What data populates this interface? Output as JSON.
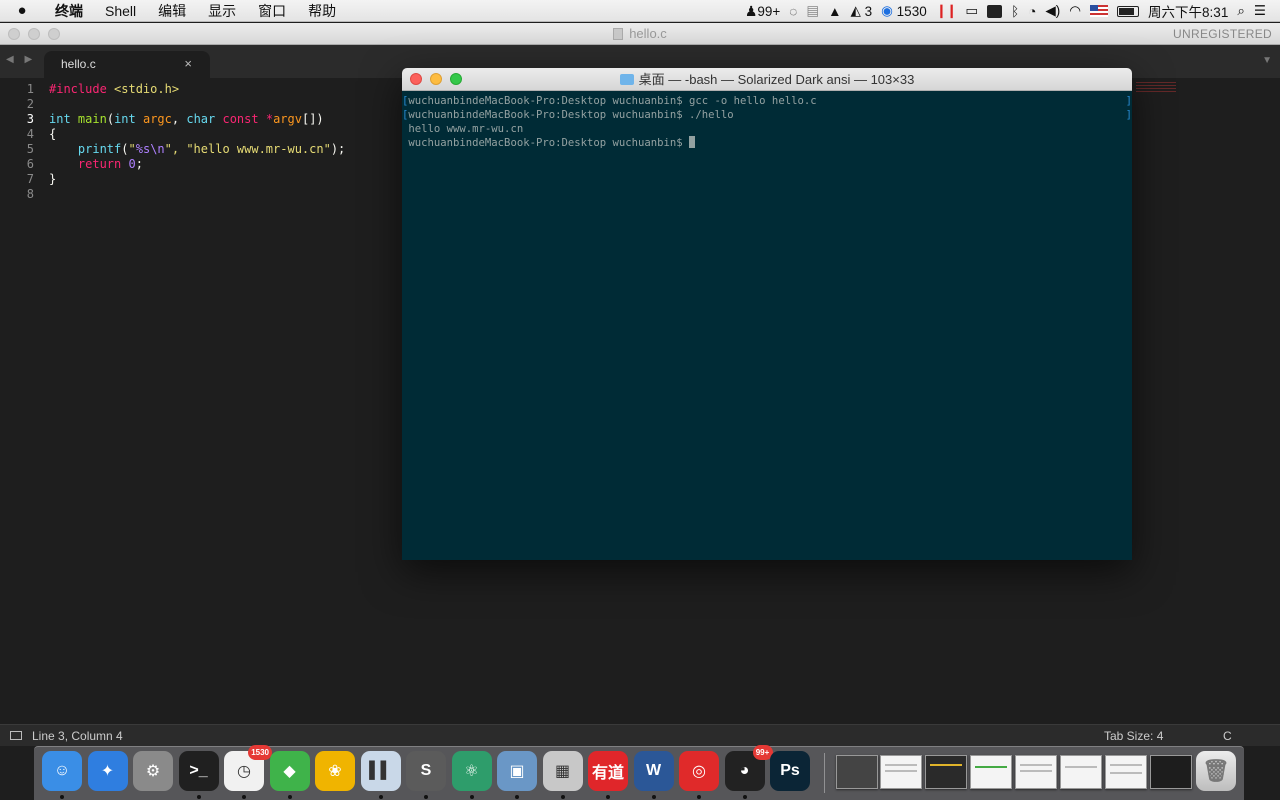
{
  "menubar": {
    "apple": "",
    "items": [
      "终端",
      "Shell",
      "编辑",
      "显示",
      "窗口",
      "帮助"
    ],
    "status": {
      "qq_badge": "99+",
      "adobe_count": "3",
      "timer_count": "1530",
      "clock": "周六下午8:31"
    }
  },
  "sublime": {
    "window_title": "hello.c",
    "unregistered": "UNREGISTERED",
    "tab_label": "hello.c",
    "tab_close": "×",
    "line_numbers": [
      "1",
      "2",
      "3",
      "4",
      "5",
      "6",
      "7",
      "8"
    ],
    "code": {
      "l1_directive": "#include",
      "l1_header": "<stdio.h>",
      "l3_type": "int",
      "l3_fn": "main",
      "l3_open": "(",
      "l3_type2": "int",
      "l3_param1": "argc",
      "l3_comma": ", ",
      "l3_type3": "char",
      "l3_const": "const",
      "l3_star": "*",
      "l3_param2": "argv",
      "l3_close": "[])",
      "l4": "{",
      "l5_fn": "printf",
      "l5_open": "(",
      "l5_q1": "\"",
      "l5_fmt": "%s",
      "l5_esc": "\\n",
      "l5_str1_end": "\", ",
      "l5_str2": "\"hello www.mr-wu.cn\"",
      "l5_end": ");",
      "l6_kw": "return",
      "l6_num": "0",
      "l6_end": ";",
      "l7": "}"
    },
    "status": {
      "position": "Line 3, Column 4",
      "tab_size": "Tab Size: 4",
      "syntax": "C"
    }
  },
  "terminal": {
    "title": "桌面 — -bash — Solarized Dark ansi — 103×33",
    "lines": [
      "wuchuanbindeMacBook-Pro:Desktop wuchuanbin$ gcc -o hello hello.c",
      "wuchuanbindeMacBook-Pro:Desktop wuchuanbin$ ./hello",
      "hello www.mr-wu.cn",
      "wuchuanbindeMacBook-Pro:Desktop wuchuanbin$ "
    ]
  },
  "dock": {
    "apps": [
      {
        "name": "finder-icon",
        "glyph": "☺",
        "color": "#3a8ee6"
      },
      {
        "name": "safari-icon",
        "glyph": "✦",
        "color": "#2f7ee0"
      },
      {
        "name": "system-preferences-icon",
        "glyph": "⚙",
        "color": "#8a8a8a"
      },
      {
        "name": "terminal-icon",
        "glyph": ">_",
        "color": "#202020"
      },
      {
        "name": "time-tracker-icon",
        "glyph": "◷",
        "color": "#f1f1f1",
        "badge": "1530"
      },
      {
        "name": "evernote-icon",
        "glyph": "◆",
        "color": "#3fb34a"
      },
      {
        "name": "tes-icon",
        "glyph": "❀",
        "color": "#f0b400"
      },
      {
        "name": "parallels-icon",
        "glyph": "▌▌",
        "color": "#c9d8e8"
      },
      {
        "name": "sublime-text-icon",
        "glyph": "S",
        "color": "#5b5b5b"
      },
      {
        "name": "atom-icon",
        "glyph": "⚛",
        "color": "#2e9d6b"
      },
      {
        "name": "preview-icon",
        "glyph": "▣",
        "color": "#6a97c6"
      },
      {
        "name": "calculator-icon",
        "glyph": "▦",
        "color": "#c8c8c8"
      },
      {
        "name": "youdao-dictionary-icon",
        "glyph": "有道",
        "color": "#e0262a"
      },
      {
        "name": "word-icon",
        "glyph": "W",
        "color": "#2b5797"
      },
      {
        "name": "netease-music-icon",
        "glyph": "◎",
        "color": "#e02a2a"
      },
      {
        "name": "qq-icon",
        "glyph": "◕",
        "color": "#222222",
        "badge": "99+"
      },
      {
        "name": "photoshop-icon",
        "glyph": "Ps",
        "color": "#0b2536"
      }
    ]
  }
}
